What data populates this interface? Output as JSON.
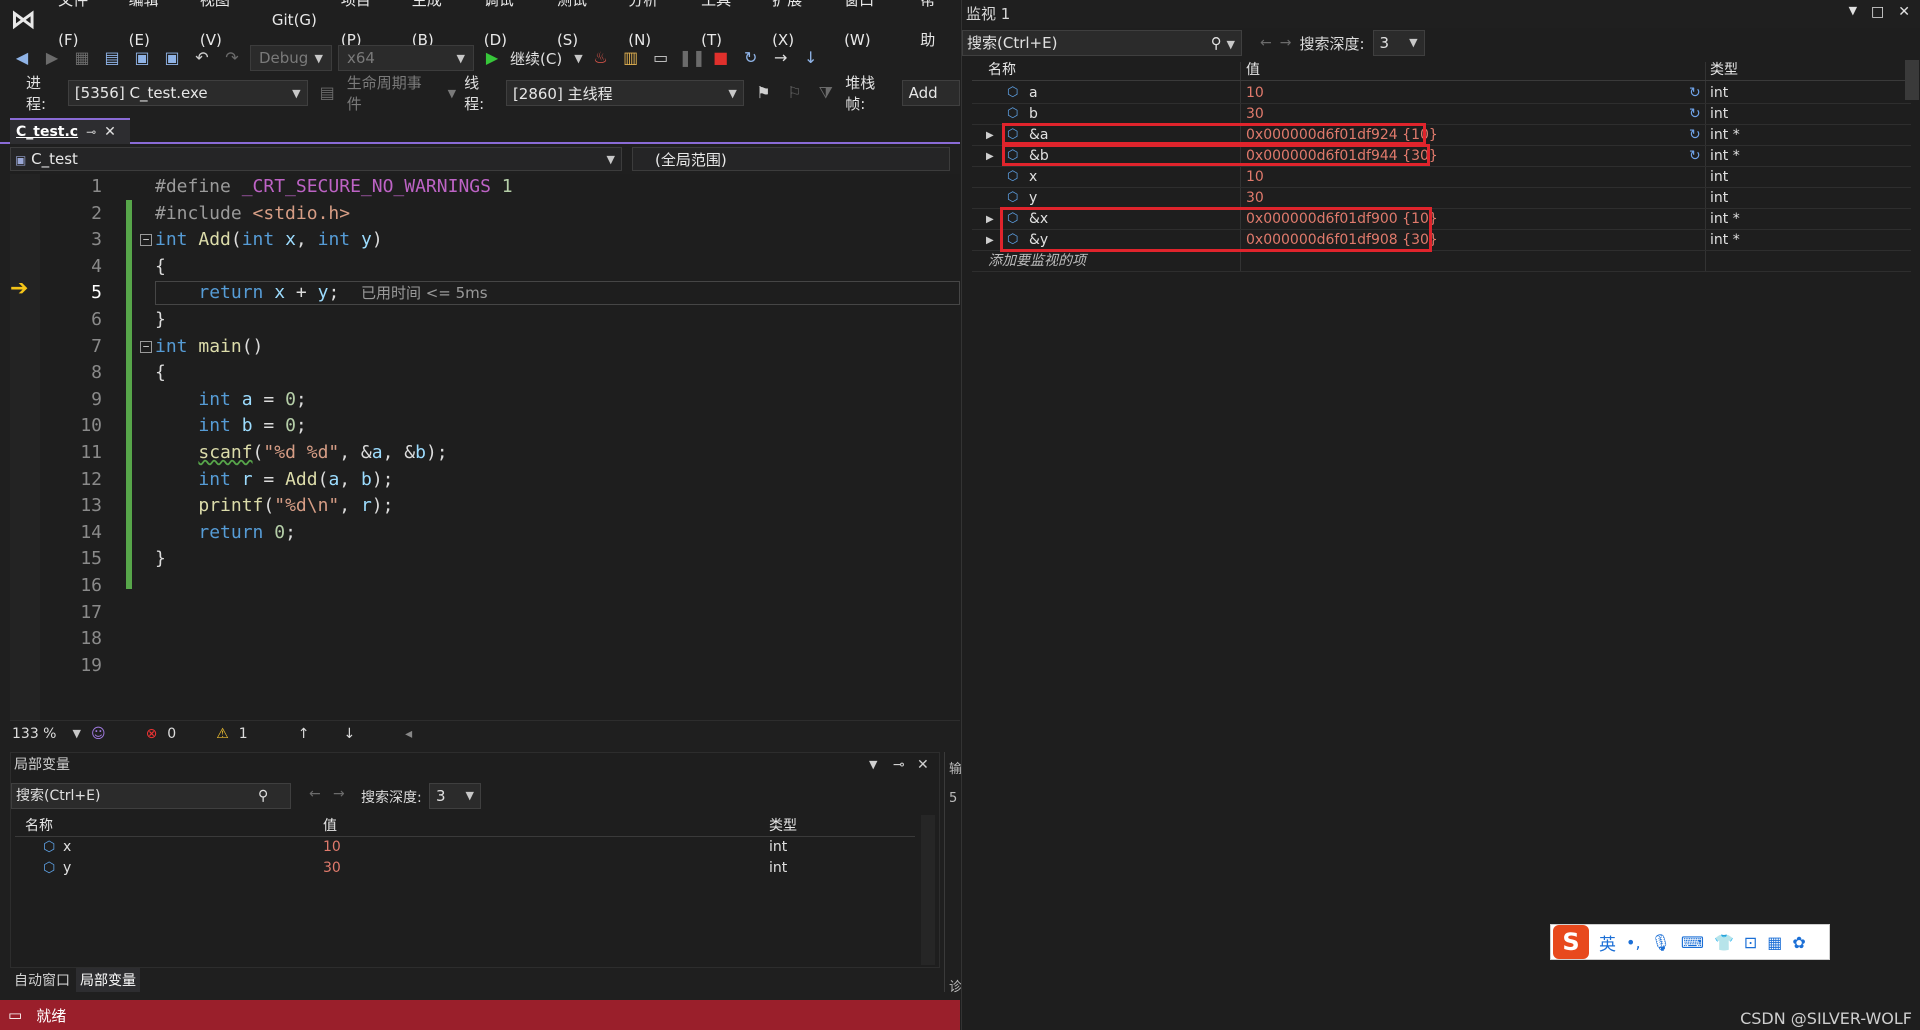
{
  "menu": {
    "items": [
      "文件(F)",
      "编辑(E)",
      "视图(V)",
      "Git(G)",
      "项目(P)",
      "生成(B)",
      "调试(D)",
      "测试(S)",
      "分析(N)",
      "工具(T)",
      "扩展(X)",
      "窗口(W)",
      "帮助"
    ]
  },
  "toolbar": {
    "config": "Debug",
    "platform": "x64",
    "continue_label": "继续(C)"
  },
  "debug_bar": {
    "process_label": "进程:",
    "process_value": "[5356] C_test.exe",
    "lifecycle_label": "生命周期事件",
    "thread_label": "线程:",
    "thread_value": "[2860] 主线程",
    "stack_label": "堆栈帧:",
    "stack_value": "Add"
  },
  "doc_tab": {
    "label": "C_test.c"
  },
  "nav": {
    "project": "C_test",
    "scope": "(全局范围)"
  },
  "editor": {
    "current_line": 5,
    "inline_hint": "已用时间 <= 5ms",
    "line_numbers": [
      "1",
      "2",
      "3",
      "4",
      "5",
      "6",
      "7",
      "8",
      "9",
      "10",
      "11",
      "12",
      "13",
      "14",
      "15",
      "16",
      "17",
      "18",
      "19"
    ],
    "zoom": "133 %",
    "errors": "0",
    "warnings": "1"
  },
  "locals": {
    "title": "局部变量",
    "search_placeholder": "搜索(Ctrl+E)",
    "depth_label": "搜索深度:",
    "depth_value": "3",
    "columns": [
      "名称",
      "值",
      "类型"
    ],
    "rows": [
      {
        "name": "x",
        "value": "10",
        "type": "int"
      },
      {
        "name": "y",
        "value": "30",
        "type": "int"
      }
    ],
    "tabs": [
      "自动窗口",
      "局部变量"
    ]
  },
  "mid_panel": {
    "chars": [
      "输",
      "5",
      "诊"
    ]
  },
  "statusbar": {
    "text": "就绪"
  },
  "watch": {
    "title": "监视 1",
    "search_placeholder": "搜索(Ctrl+E)",
    "depth_label": "搜索深度:",
    "depth_value": "3",
    "columns": [
      "名称",
      "值",
      "类型"
    ],
    "rows": [
      {
        "name": "a",
        "value": "10",
        "type": "int",
        "expandable": false,
        "refresh": true
      },
      {
        "name": "b",
        "value": "30",
        "type": "int",
        "expandable": false,
        "refresh": true
      },
      {
        "name": "&a",
        "value": "0x000000d6f01df924 {10}",
        "type": "int *",
        "expandable": true,
        "refresh": true
      },
      {
        "name": "&b",
        "value": "0x000000d6f01df944 {30}",
        "type": "int *",
        "expandable": true,
        "refresh": true
      },
      {
        "name": "x",
        "value": "10",
        "type": "int",
        "expandable": false,
        "refresh": false
      },
      {
        "name": "y",
        "value": "30",
        "type": "int",
        "expandable": false,
        "refresh": false
      },
      {
        "name": "&x",
        "value": "0x000000d6f01df900 {10}",
        "type": "int *",
        "expandable": true,
        "refresh": false
      },
      {
        "name": "&y",
        "value": "0x000000d6f01df908 {30}",
        "type": "int *",
        "expandable": true,
        "refresh": false
      }
    ],
    "add_item": "添加要监视的项"
  },
  "ime": {
    "logo": "S",
    "mode": "英"
  },
  "watermark": "CSDN @SILVER-WOLF",
  "colors": {
    "accent": "#8a6bd6",
    "status_bar": "#9a1f2b",
    "highlight_box": "#e0242c",
    "value_changed": "#e07a6c"
  }
}
